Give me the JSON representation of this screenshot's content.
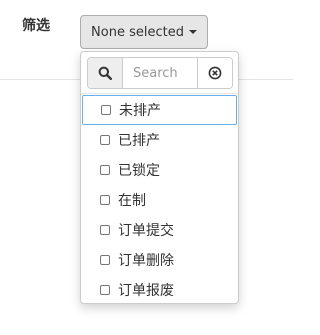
{
  "filter": {
    "label": "筛选"
  },
  "dropdown": {
    "button_label": "None selected",
    "search_placeholder": "Search",
    "options": [
      {
        "label": "未排产",
        "checked": false
      },
      {
        "label": "已排产",
        "checked": false
      },
      {
        "label": "已锁定",
        "checked": false
      },
      {
        "label": "在制",
        "checked": false
      },
      {
        "label": "订单提交",
        "checked": false
      },
      {
        "label": "订单删除",
        "checked": false
      },
      {
        "label": "订单报废",
        "checked": false
      }
    ]
  },
  "icons": {
    "search": "search-icon",
    "clear": "clear-circle-icon",
    "caret": "caret-down-icon"
  },
  "colors": {
    "button_bg": "#e6e6e6",
    "focus_border": "#66afe9"
  }
}
